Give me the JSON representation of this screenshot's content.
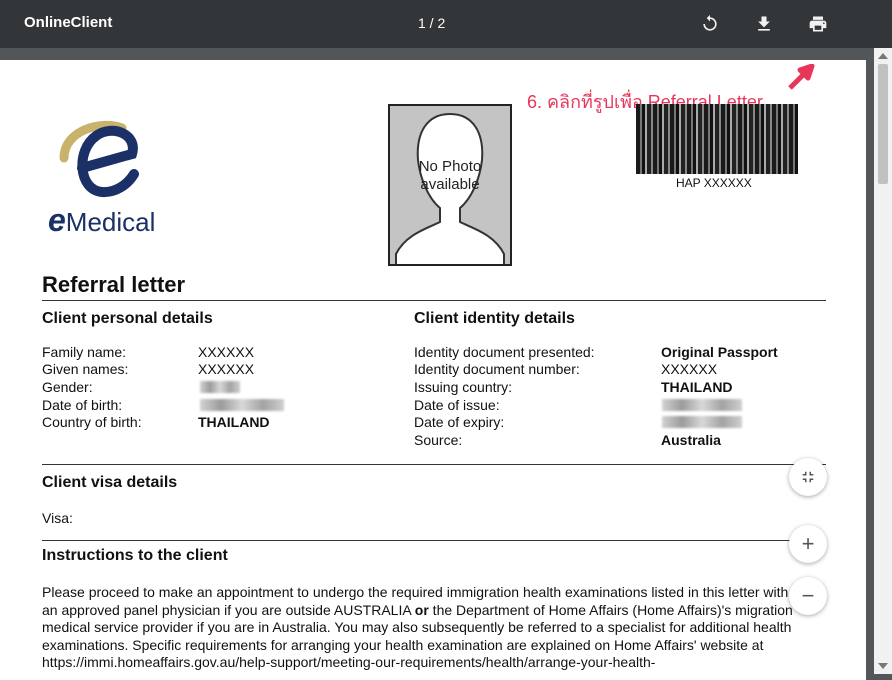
{
  "toolbar": {
    "title": "OnlineClient",
    "page_indicator": "1 / 2",
    "icons": [
      "rotate-icon",
      "download-icon",
      "print-icon"
    ]
  },
  "annotation": "6. คลิกที่รูปเพื่อ Referral Letter",
  "logo": {
    "text_e": "e",
    "text_medical": "Medical"
  },
  "photo": {
    "line1": "No Photo",
    "line2": "available"
  },
  "barcode": {
    "label": "HAP XXXXXX"
  },
  "letter": {
    "title": "Referral letter",
    "personal": {
      "heading": "Client personal details",
      "labels": [
        "Family name:",
        "Given names:",
        "Gender:",
        "Date of birth:",
        "Country of birth:"
      ],
      "values": [
        "XXXXXX",
        "XXXXXX",
        "",
        "",
        "THAILAND"
      ]
    },
    "identity": {
      "heading": "Client identity details",
      "labels": [
        "Identity document presented:",
        "Identity document number:",
        "Issuing country:",
        "Date of issue:",
        "Date of expiry:",
        "Source:"
      ],
      "values": [
        "Original Passport",
        "XXXXXX",
        "THAILAND",
        "",
        "",
        "Australia"
      ]
    },
    "visa": {
      "heading": "Client visa details",
      "label": "Visa:"
    },
    "instructions": {
      "heading": "Instructions to the client",
      "part1": "Please proceed to make an appointment to undergo the required immigration health examinations listed in this letter with an approved panel physician if you are outside AUSTRALIA ",
      "bold": "or",
      "part2": " the Department of Home Affairs (Home Affairs)'s migration medical service provider if you are in Australia. You may also subsequently be referred to a specialist for additional health examinations. Specific requirements for arranging your health examination are explained on Home Affairs' website at https://immi.homeaffairs.gov.au/help-support/meeting-our-requirements/health/arrange-your-health-"
    }
  },
  "zoom": {
    "fit": "fit-page",
    "plus": "+",
    "minus": "−"
  },
  "colors": {
    "toolbar": "#323639",
    "annotation": "#e8355a",
    "logo_blue": "#1a3066",
    "logo_gold": "#c9b26b"
  }
}
